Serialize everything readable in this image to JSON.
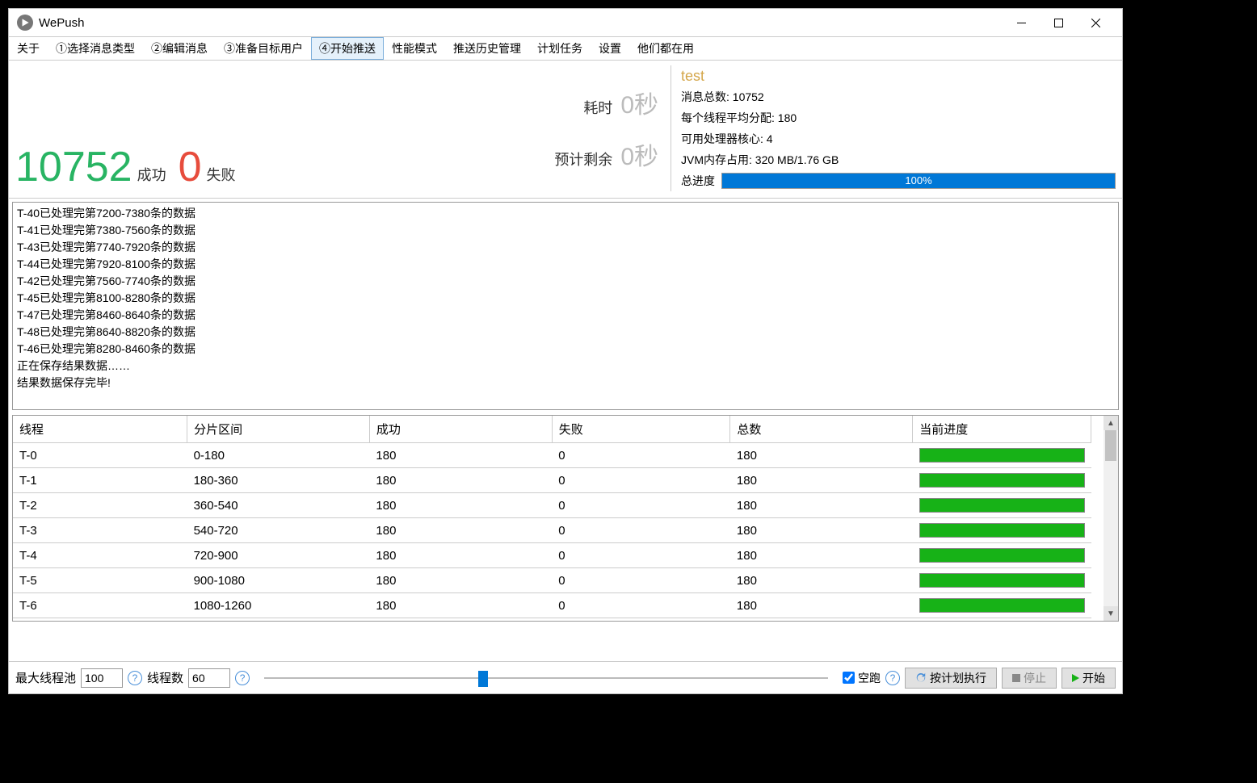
{
  "window": {
    "title": "WePush"
  },
  "menu": {
    "items": [
      "关于",
      "①选择消息类型",
      "②编辑消息",
      "③准备目标用户",
      "④开始推送",
      "性能模式",
      "推送历史管理",
      "计划任务",
      "设置",
      "他们都在用"
    ],
    "active": 4
  },
  "summary": {
    "success_count": "10752",
    "success_label": "成功",
    "fail_count": "0",
    "fail_label": "失败",
    "elapsed_label": "耗时",
    "elapsed_value": "0秒",
    "remain_label": "预计剩余",
    "remain_value": "0秒"
  },
  "info": {
    "name": "test",
    "total_label": "消息总数:",
    "total_value": "10752",
    "per_thread_label": "每个线程平均分配:",
    "per_thread_value": "180",
    "cores_label": "可用处理器核心:",
    "cores_value": "4",
    "jvm_label": "JVM内存占用:",
    "jvm_value": "320 MB/1.76 GB",
    "progress_label": "总进度",
    "progress_text": "100%",
    "progress_pct": 100
  },
  "log": [
    "T-40已处理完第7200-7380条的数据",
    "T-41已处理完第7380-7560条的数据",
    "T-43已处理完第7740-7920条的数据",
    "T-44已处理完第7920-8100条的数据",
    "T-42已处理完第7560-7740条的数据",
    "T-45已处理完第8100-8280条的数据",
    "T-47已处理完第8460-8640条的数据",
    "T-48已处理完第8640-8820条的数据",
    "T-46已处理完第8280-8460条的数据",
    "正在保存结果数据……",
    "结果数据保存完毕!"
  ],
  "table": {
    "headers": [
      "线程",
      "分片区间",
      "成功",
      "失败",
      "总数",
      "当前进度"
    ],
    "rows": [
      {
        "thread": "T-0",
        "range": "0-180",
        "succ": "180",
        "fail": "0",
        "total": "180",
        "pct": 100
      },
      {
        "thread": "T-1",
        "range": "180-360",
        "succ": "180",
        "fail": "0",
        "total": "180",
        "pct": 100
      },
      {
        "thread": "T-2",
        "range": "360-540",
        "succ": "180",
        "fail": "0",
        "total": "180",
        "pct": 100
      },
      {
        "thread": "T-3",
        "range": "540-720",
        "succ": "180",
        "fail": "0",
        "total": "180",
        "pct": 100
      },
      {
        "thread": "T-4",
        "range": "720-900",
        "succ": "180",
        "fail": "0",
        "total": "180",
        "pct": 100
      },
      {
        "thread": "T-5",
        "range": "900-1080",
        "succ": "180",
        "fail": "0",
        "total": "180",
        "pct": 100
      },
      {
        "thread": "T-6",
        "range": "1080-1260",
        "succ": "180",
        "fail": "0",
        "total": "180",
        "pct": 100
      }
    ]
  },
  "bottom": {
    "max_pool_label": "最大线程池",
    "max_pool_value": "100",
    "thread_count_label": "线程数",
    "thread_count_value": "60",
    "dry_run_label": "空跑",
    "dry_run_checked": true,
    "schedule_label": "按计划执行",
    "stop_label": "停止",
    "start_label": "开始"
  }
}
